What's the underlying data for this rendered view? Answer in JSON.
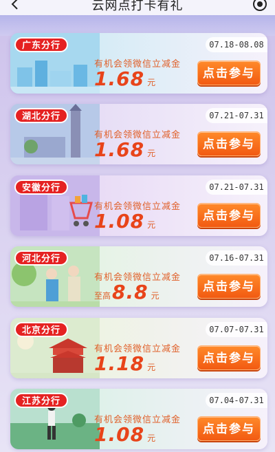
{
  "header": {
    "title": "云网点打卡有礼"
  },
  "cards": [
    {
      "branch": "广东分行",
      "date": "07.18-08.08",
      "desc": "有机会领微信立减金",
      "prefix": "",
      "amount": "1.68",
      "unit": "元",
      "button": "点击参与",
      "colors": {
        "bg": "#d6ecf6",
        "art": "#a7d8ef"
      }
    },
    {
      "branch": "湖北分行",
      "date": "07.21-07.31",
      "desc": "有机会领微信立减金",
      "prefix": "",
      "amount": "1.68",
      "unit": "元",
      "button": "点击参与",
      "colors": {
        "bg": "#e7def6",
        "art": "#b7c9e8"
      }
    },
    {
      "branch": "安徽分行",
      "date": "07.21-07.31",
      "desc": "有机会领微信立减金",
      "prefix": "",
      "amount": "1.08",
      "unit": "元",
      "button": "点击参与",
      "colors": {
        "bg": "#e9dcf6",
        "art": "#c8b7ea"
      }
    },
    {
      "branch": "河北分行",
      "date": "07.16-07.31",
      "desc": "有机会领微信立减金",
      "prefix": "至高",
      "amount": "8.8",
      "unit": "元",
      "button": "点击参与",
      "colors": {
        "bg": "#e6f3e6",
        "art": "#c6e4c0"
      }
    },
    {
      "branch": "北京分行",
      "date": "07.07-07.31",
      "desc": "有机会领微信立减金",
      "prefix": "",
      "amount": "1.18",
      "unit": "元",
      "button": "点击参与",
      "colors": {
        "bg": "#eef3e4",
        "art": "#dcebcf"
      }
    },
    {
      "branch": "江苏分行",
      "date": "07.04-07.31",
      "desc": "有机会领微信立减金",
      "prefix": "",
      "amount": "1.08",
      "unit": "元",
      "button": "点击参与",
      "colors": {
        "bg": "#dff1ea",
        "art": "#b9e0cf"
      }
    }
  ]
}
